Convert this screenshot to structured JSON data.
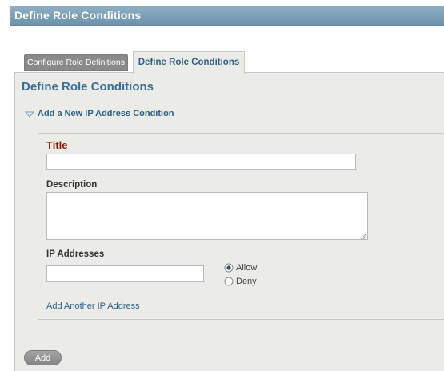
{
  "header": {
    "title": "Define Role Conditions"
  },
  "tabs": [
    {
      "label": "Configure Role Definitions",
      "active": false
    },
    {
      "label": "Define Role Conditions",
      "active": true
    }
  ],
  "panel": {
    "title": "Define Role Conditions",
    "section_label": "Add a New IP Address Condition"
  },
  "form": {
    "title_label": "Title",
    "title_value": "",
    "description_label": "Description",
    "description_value": "",
    "ip_label": "IP Addresses",
    "ip_value": "",
    "radio_options": [
      {
        "label": "Allow",
        "checked": true
      },
      {
        "label": "Deny",
        "checked": false
      }
    ],
    "add_ip_link": "Add Another IP Address"
  },
  "actions": {
    "add_label": "Add"
  },
  "colors": {
    "header_bar": "#7a9db3",
    "tab_inactive": "#8a8a8a",
    "panel_bg": "#ebebe7",
    "link_blue": "#2b5f85",
    "title_red": "#8b1a00"
  },
  "icons": {
    "section_toggle": "triangle-down-icon",
    "radio_checked": "radio-checked-icon",
    "radio_unchecked": "radio-unchecked-icon",
    "textarea_grip": "resize-grip-icon"
  }
}
